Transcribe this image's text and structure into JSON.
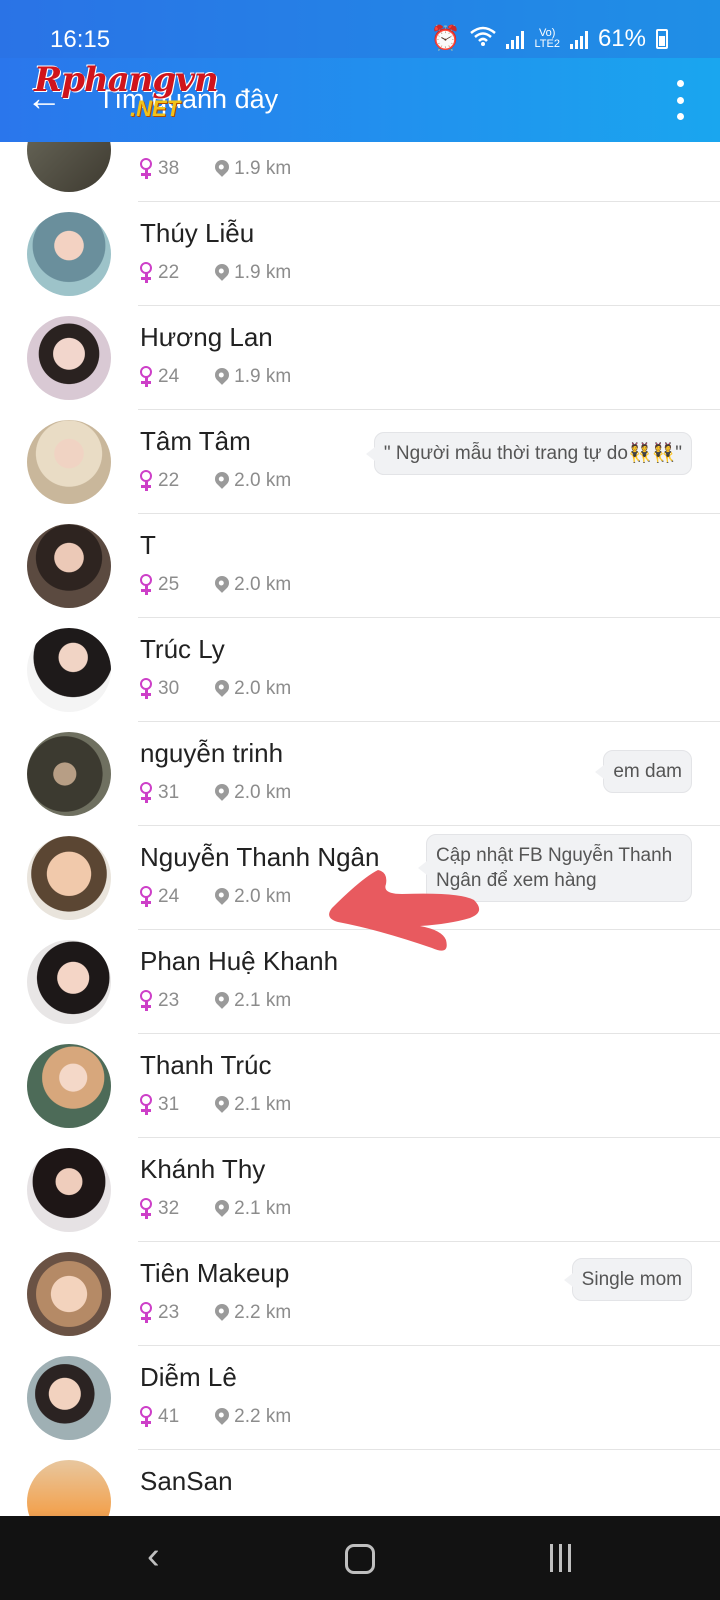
{
  "status_bar": {
    "time": "16:15",
    "network_top": "Vo)",
    "network_bottom": "LTE2",
    "battery": "61%"
  },
  "app_bar": {
    "title": "Tìm quanh đây",
    "watermark": "Rphangvn",
    "watermark_sub": ".NET"
  },
  "people": [
    {
      "name": "",
      "age": "38",
      "distance": "1.9 km",
      "bubble": ""
    },
    {
      "name": "Thúy Liễu",
      "age": "22",
      "distance": "1.9 km",
      "bubble": ""
    },
    {
      "name": "Hương Lan",
      "age": "24",
      "distance": "1.9 km",
      "bubble": ""
    },
    {
      "name": "Tâm Tâm",
      "age": "22",
      "distance": "2.0 km",
      "bubble": "\" Người mẫu thời trang tự do👯👯\""
    },
    {
      "name": "T",
      "age": "25",
      "distance": "2.0 km",
      "bubble": ""
    },
    {
      "name": "Trúc Ly",
      "age": "30",
      "distance": "2.0 km",
      "bubble": ""
    },
    {
      "name": "nguyễn trinh",
      "age": "31",
      "distance": "2.0 km",
      "bubble": "em dam"
    },
    {
      "name": "Nguyễn Thanh Ngân",
      "age": "24",
      "distance": "2.0 km",
      "bubble": "Cập nhật FB Nguyễn Thanh Ngân để xem hàng"
    },
    {
      "name": "Phan Huệ Khanh",
      "age": "23",
      "distance": "2.1 km",
      "bubble": ""
    },
    {
      "name": "Thanh Trúc",
      "age": "31",
      "distance": "2.1 km",
      "bubble": ""
    },
    {
      "name": "Khánh Thy",
      "age": "32",
      "distance": "2.1 km",
      "bubble": ""
    },
    {
      "name": "Tiên Makeup",
      "age": "23",
      "distance": "2.2 km",
      "bubble": "Single mom"
    },
    {
      "name": "Diễm Lê",
      "age": "41",
      "distance": "2.2 km",
      "bubble": ""
    },
    {
      "name": "SanSan",
      "age": "",
      "distance": "",
      "bubble": ""
    }
  ],
  "colors": {
    "app_bar": "#2a76ec",
    "female_icon": "#cd3fc8",
    "annotation_arrow": "#e85a5f"
  }
}
